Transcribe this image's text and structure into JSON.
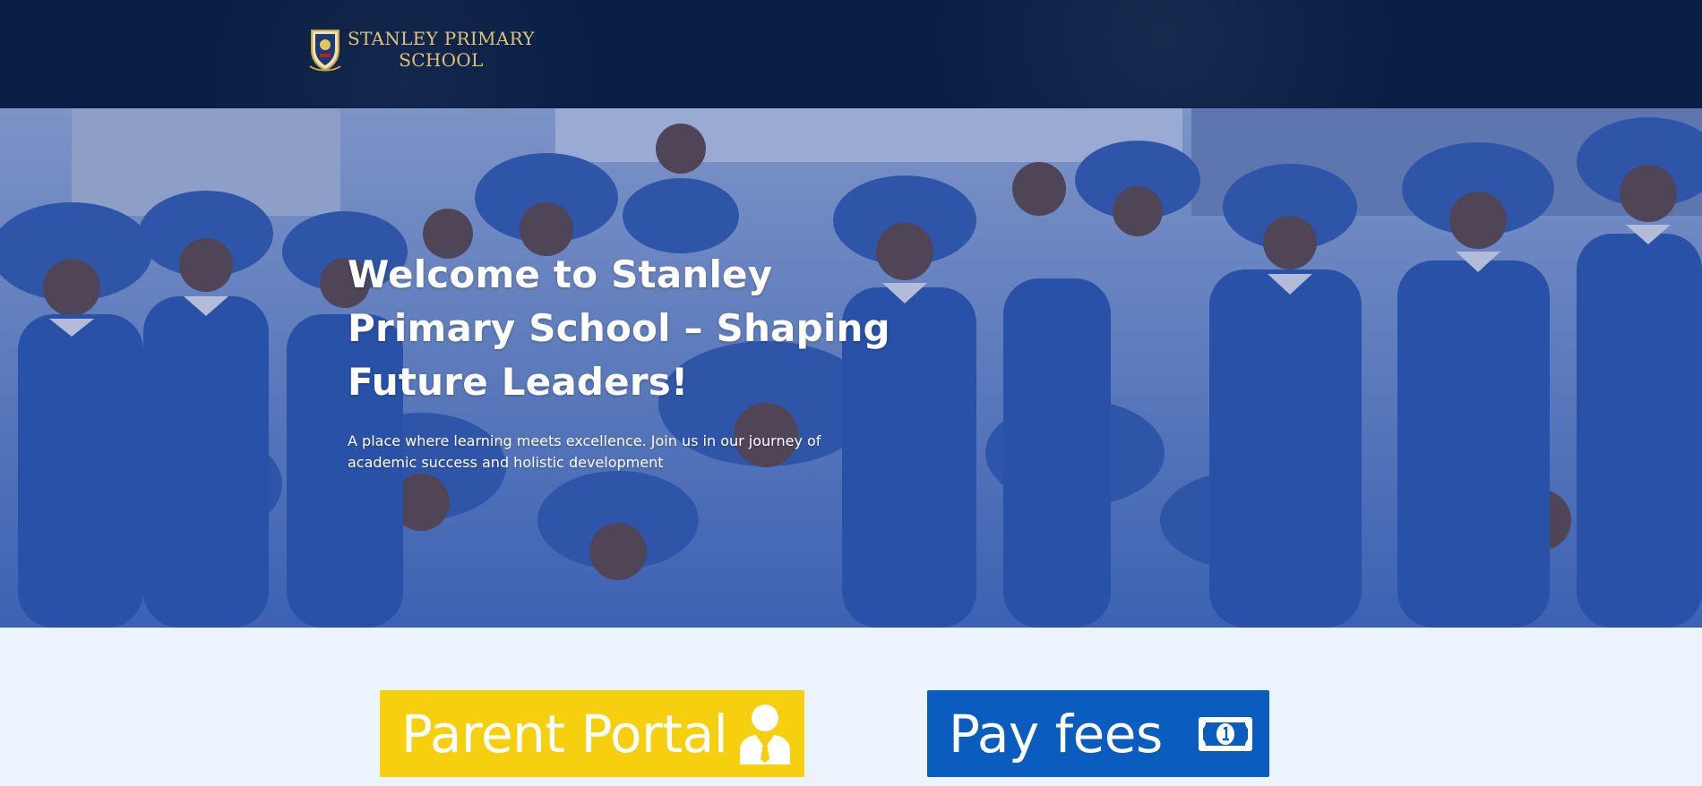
{
  "header": {
    "logo": {
      "line1": "STANLEY PRIMARY",
      "line2": "SCHOOL"
    }
  },
  "hero": {
    "title": "Welcome to Stanley Primary School – Shaping Future Leaders!",
    "subtitle": "A place where learning meets excellence. Join us in our journey of academic success and holistic development"
  },
  "actions": {
    "parent_portal": {
      "label": "Parent Portal",
      "icon": "user-tie-icon"
    },
    "pay_fees": {
      "label": "Pay fees",
      "icon": "money-bill-icon"
    }
  },
  "colors": {
    "header_bg": "#0a1f45",
    "hero_tint": "#3c5aaa",
    "portal_yellow": "#f6cf0e",
    "fees_blue": "#0b5cbf",
    "page_bg": "#ebf3fd",
    "logo_gold": "#e0c27a"
  }
}
